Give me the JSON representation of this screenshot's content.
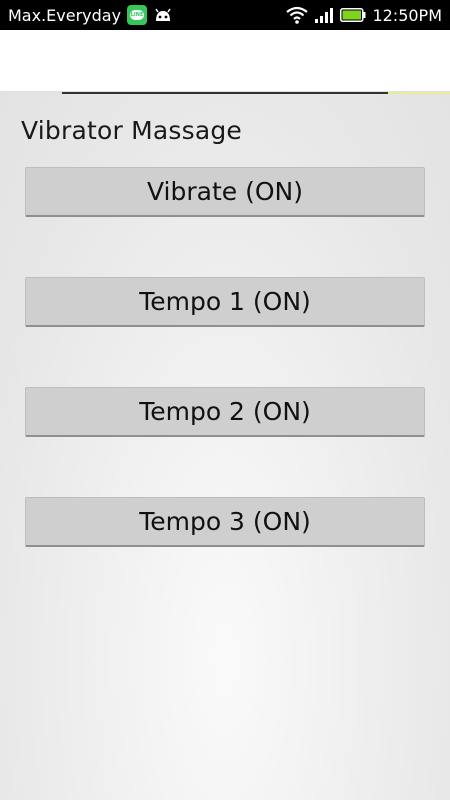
{
  "status_bar": {
    "carrier": "Max.Everyday",
    "time": "12:50PM",
    "line_icon_text": "LINE"
  },
  "app": {
    "title": "Vibrator Massage"
  },
  "buttons": [
    {
      "label": "Vibrate (ON)"
    },
    {
      "label": "Tempo 1 (ON)"
    },
    {
      "label": "Tempo 2 (ON)"
    },
    {
      "label": "Tempo 3 (ON)"
    }
  ],
  "colors": {
    "status_bar_bg": "#000000",
    "action_bar_bg": "#ffffff",
    "button_bg": "#cfcfcf",
    "battery_green": "#7ed321",
    "line_green": "#34c759"
  },
  "icons": [
    "line-icon",
    "android-debug-icon",
    "wifi-icon",
    "signal-icon",
    "battery-icon"
  ]
}
